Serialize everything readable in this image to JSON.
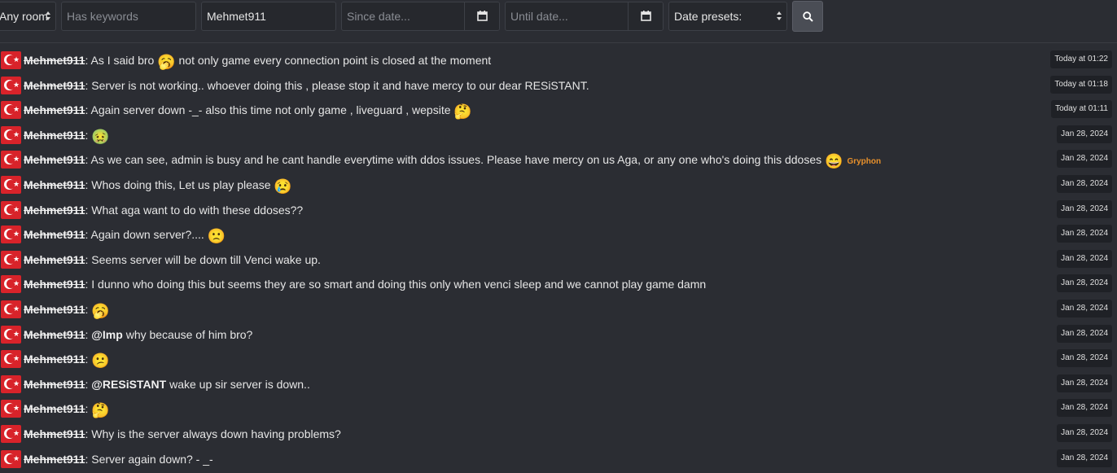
{
  "filters": {
    "room": "Any room",
    "keywords_placeholder": "Has keywords",
    "user_value": "Mehmet911",
    "since_placeholder": "Since date...",
    "until_placeholder": "Until date...",
    "presets": "Date presets:"
  },
  "messages": [
    {
      "user": "Mehmet911",
      "pre": "As I said bro ",
      "emoji": "🥱",
      "post": " not only game every connection point is closed at the moment",
      "time": "Today at 01:22"
    },
    {
      "user": "Mehmet911",
      "pre": "Server is not working.. whoever doing this , please stop it and have mercy to our dear RESiSTANT.",
      "time": "Today at 01:18"
    },
    {
      "user": "Mehmet911",
      "pre": "Again server down -_- also this time not only game , liveguard , wepsite ",
      "emoji": "🤔",
      "time": "Today at 01:11"
    },
    {
      "user": "Mehmet911",
      "emoji": "🤢",
      "time": "Jan 28, 2024"
    },
    {
      "user": "Mehmet911",
      "pre": "As we can see, admin is busy and he cant handle everytime with ddos issues. Please have mercy on us Aga, or any one who's doing this ddoses ",
      "emoji": "😄",
      "tag": "Gryphon",
      "time": "Jan 28, 2024"
    },
    {
      "user": "Mehmet911",
      "pre": "Whos doing this, Let us play please ",
      "emoji": "😢",
      "time": "Jan 28, 2024"
    },
    {
      "user": "Mehmet911",
      "pre": "What aga want to do with these ddoses??",
      "time": "Jan 28, 2024"
    },
    {
      "user": "Mehmet911",
      "pre": "Again down server?.... ",
      "emoji": "🙁",
      "time": "Jan 28, 2024"
    },
    {
      "user": "Mehmet911",
      "pre": "Seems server will be down till Venci wake up.",
      "time": "Jan 28, 2024"
    },
    {
      "user": "Mehmet911",
      "pre": "I dunno who doing this but seems they are so smart and doing this only when venci sleep and we cannot play game damn",
      "time": "Jan 28, 2024"
    },
    {
      "user": "Mehmet911",
      "emoji": "🥱",
      "time": "Jan 28, 2024"
    },
    {
      "user": "Mehmet911",
      "mention": "@Imp",
      "post": " why because of him bro?",
      "time": "Jan 28, 2024"
    },
    {
      "user": "Mehmet911",
      "emoji": "😕",
      "time": "Jan 28, 2024"
    },
    {
      "user": "Mehmet911",
      "mention": "@RESiSTANT",
      "post": " wake up sir server is down..",
      "time": "Jan 28, 2024"
    },
    {
      "user": "Mehmet911",
      "emoji": "🤔",
      "time": "Jan 28, 2024"
    },
    {
      "user": "Mehmet911",
      "pre": "Why is the server always down having problems?",
      "time": "Jan 28, 2024"
    },
    {
      "user": "Mehmet911",
      "pre": "Server again down? - _-",
      "time": "Jan 28, 2024"
    }
  ]
}
